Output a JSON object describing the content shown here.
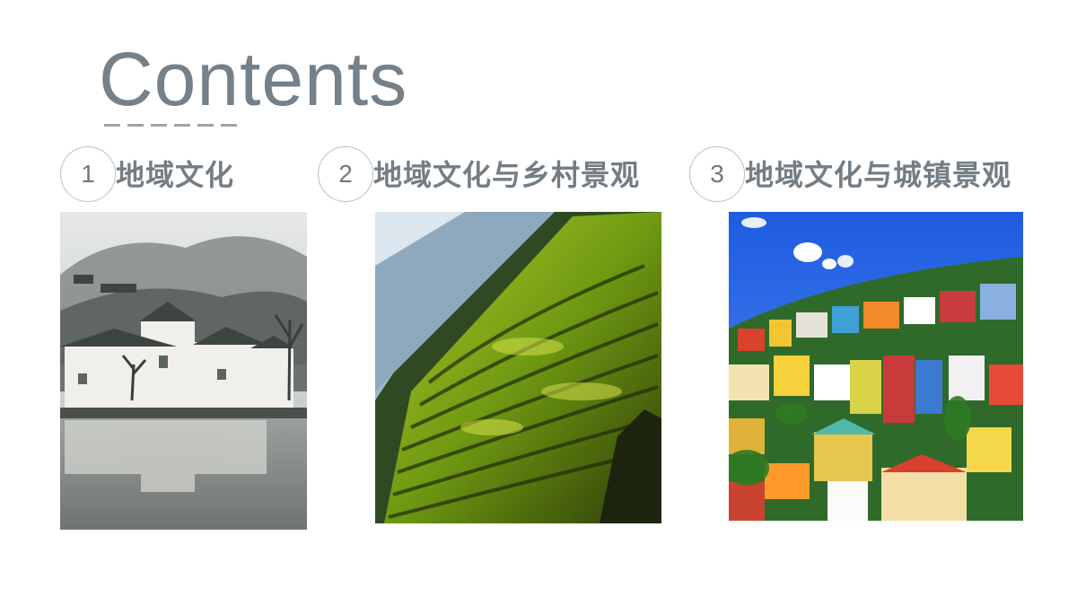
{
  "slide": {
    "title": "Contents",
    "items": [
      {
        "number": "1",
        "label": "地域文化",
        "image": "huizhou-village-reflection-photo"
      },
      {
        "number": "2",
        "label": "地域文化与乡村景观",
        "image": "rice-terraces-mountain-photo"
      },
      {
        "number": "3",
        "label": "地域文化与城镇景观",
        "image": "colorful-hillside-town-photo"
      }
    ]
  }
}
